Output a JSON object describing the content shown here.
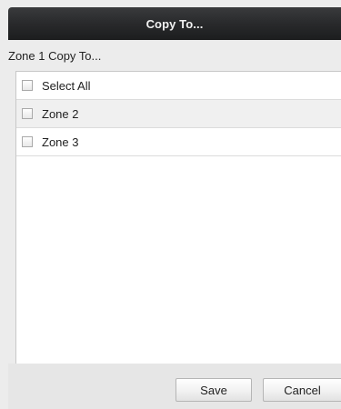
{
  "dialog": {
    "title": "Copy To..."
  },
  "section": {
    "label": "Zone 1 Copy To..."
  },
  "list": {
    "items": [
      {
        "label": "Select All",
        "checked": false
      },
      {
        "label": "Zone 2",
        "checked": false
      },
      {
        "label": "Zone 3",
        "checked": false
      }
    ]
  },
  "buttons": {
    "save_label": "Save",
    "cancel_label": "Cancel"
  }
}
